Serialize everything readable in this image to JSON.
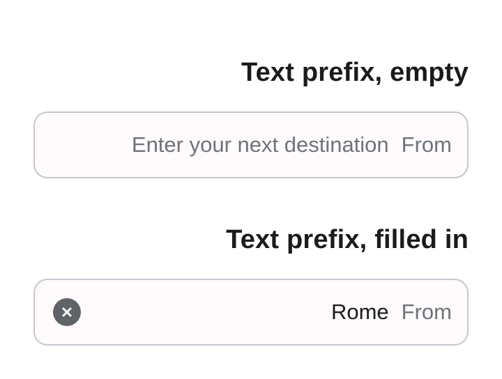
{
  "empty_section": {
    "title": "Text prefix, empty",
    "placeholder": "Enter your next destination",
    "prefix": "From"
  },
  "filled_section": {
    "title": "Text prefix, filled in",
    "value": "Rome",
    "prefix": "From",
    "clear_icon": "clear-circle-icon"
  },
  "colors": {
    "border": "#c4c7cf",
    "placeholder_text": "#6f737b",
    "clear_button": "#5f6368"
  }
}
